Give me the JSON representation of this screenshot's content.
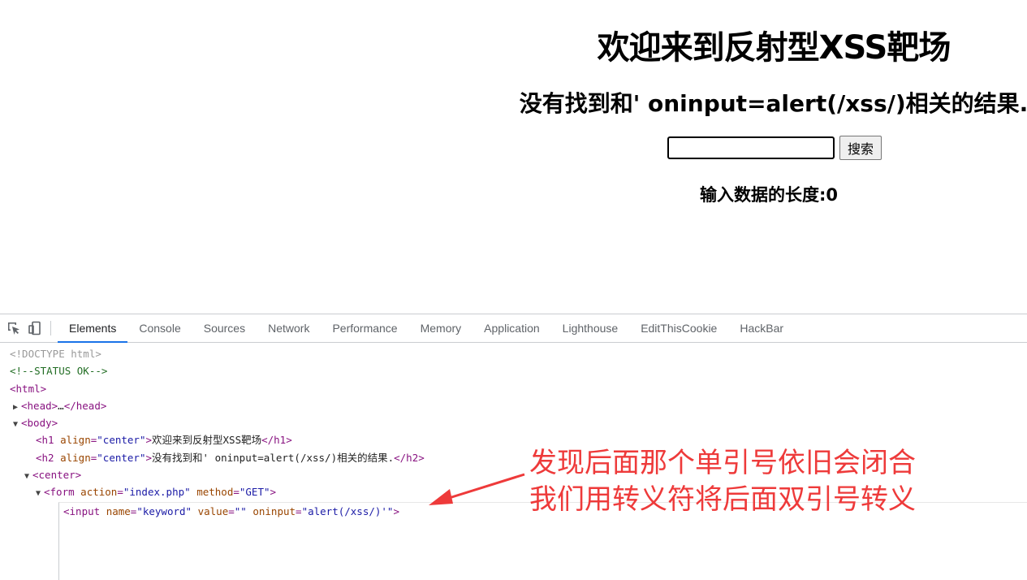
{
  "page": {
    "h1": "欢迎来到反射型XSS靶场",
    "h2": "没有找到和' oninput=alert(/xss/)相关的结果.",
    "input_value": "",
    "search_button": "搜索",
    "length_label": "输入数据的长度:0"
  },
  "devtools": {
    "tabs": [
      "Elements",
      "Console",
      "Sources",
      "Network",
      "Performance",
      "Memory",
      "Application",
      "Lighthouse",
      "EditThisCookie",
      "HackBar"
    ],
    "active_tab": "Elements",
    "dom": {
      "doctype": "<!DOCTYPE html>",
      "comment": "<!--STATUS OK-->",
      "html_open": "<html>",
      "head_tag": "<head>",
      "head_ellipsis": "…",
      "head_close": "</head>",
      "body_tag": "<body>",
      "h1_open": "<h1",
      "h1_attr": "align",
      "h1_val": "\"center\"",
      "h1_text": "欢迎来到反射型XSS靶场",
      "h1_close": "</h1>",
      "h2_open": "<h2",
      "h2_attr": "align",
      "h2_val": "\"center\"",
      "h2_text": "没有找到和' oninput=alert(/xss/)相关的结果.",
      "h2_close": "</h2>",
      "center_tag": "<center>",
      "form_open": "<form",
      "form_attr1": "action",
      "form_val1": "\"index.php\"",
      "form_attr2": "method",
      "form_val2": "\"GET\"",
      "input_open": "<input",
      "input_attr1": "name",
      "input_val1": "\"keyword\"",
      "input_attr2": "value",
      "input_val2": "\"\"",
      "input_attr3": "oninput",
      "input_val3": "\"alert(/xss/)'\"",
      "input_close": ">"
    }
  },
  "annotation": {
    "line1": "发现后面那个单引号依旧会闭合",
    "line2": "我们用转义符将后面双引号转义",
    "color": "#ee3a3a"
  }
}
